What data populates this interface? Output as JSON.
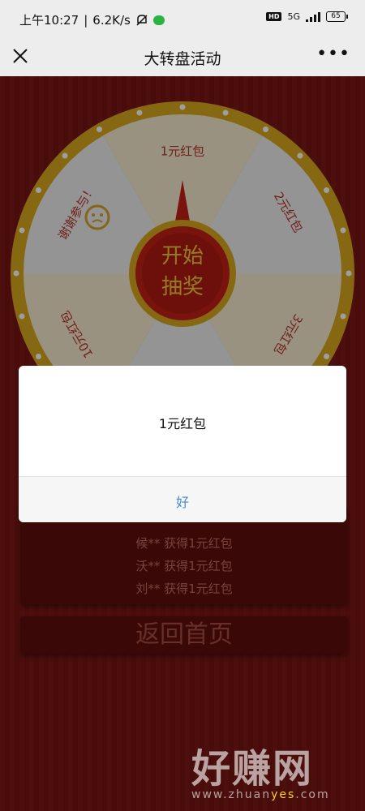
{
  "status_bar": {
    "time": "上午10:27",
    "speed": "6.2K/s",
    "network": "5G",
    "hd": "HD",
    "battery": "65"
  },
  "nav": {
    "title": "大转盘活动",
    "more": "•••"
  },
  "wheel": {
    "center_line1": "开始",
    "center_line2": "抽奖",
    "segments": [
      "1元红包",
      "2元红包",
      "3元红包",
      "10元红包",
      "谢谢参与！"
    ]
  },
  "records": [
    "候** 获得1元红包",
    "沃** 获得1元红包",
    "刘** 获得1元红包"
  ],
  "home_button": "返回首页",
  "modal": {
    "message": "1元红包",
    "ok": "好"
  },
  "watermark": {
    "main": "好赚网",
    "url_a": "www.zhuan",
    "url_b": "yes",
    "url_c": ".com"
  },
  "colors": {
    "background": "#7b1915",
    "rim": "#d9a91e",
    "pointer": "#c41f16",
    "link": "#4a8ac7"
  }
}
